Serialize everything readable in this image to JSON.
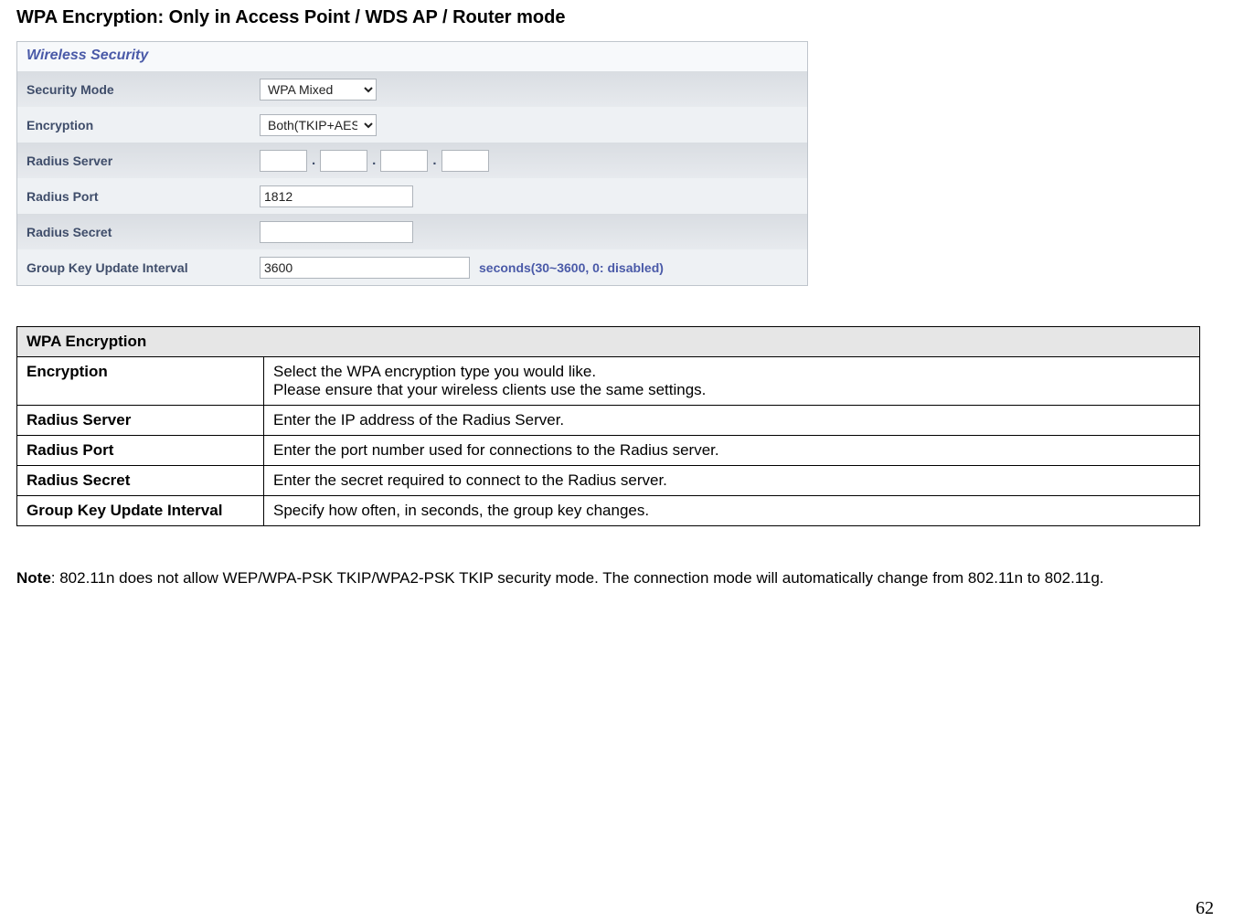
{
  "page_title": "WPA Encryption: Only in Access Point / WDS AP / Router mode",
  "form": {
    "header": "Wireless Security",
    "rows": {
      "security_mode": {
        "label": "Security Mode",
        "value": "WPA Mixed"
      },
      "encryption": {
        "label": "Encryption",
        "value": "Both(TKIP+AES)"
      },
      "radius_server": {
        "label": "Radius Server",
        "oct1": "",
        "oct2": "",
        "oct3": "",
        "oct4": ""
      },
      "radius_port": {
        "label": "Radius Port",
        "value": "1812"
      },
      "radius_secret": {
        "label": "Radius Secret",
        "value": ""
      },
      "group_key": {
        "label": "Group Key Update Interval",
        "value": "3600",
        "hint": "seconds(30~3600, 0: disabled)"
      }
    }
  },
  "desc": {
    "header": "WPA Encryption",
    "rows": [
      {
        "label": "Encryption",
        "text1": "Select the WPA encryption type you would like.",
        "text2": "Please ensure that your wireless clients use the same settings."
      },
      {
        "label": "Radius Server",
        "text1": "Enter the IP address of the Radius Server."
      },
      {
        "label": "Radius Port",
        "text1": "Enter the port number used for connections to the Radius server."
      },
      {
        "label": "Radius Secret",
        "text1": "Enter the secret required to connect to the Radius server."
      },
      {
        "label": "Group Key Update Interval",
        "text1": "Specify how often, in seconds, the group key changes."
      }
    ]
  },
  "note_label": "Note",
  "note_text": ":  802.11n does not allow WEP/WPA-PSK TKIP/WPA2-PSK TKIP security mode. The connection mode will automatically change from 802.11n to 802.11g.",
  "page_number": "62"
}
